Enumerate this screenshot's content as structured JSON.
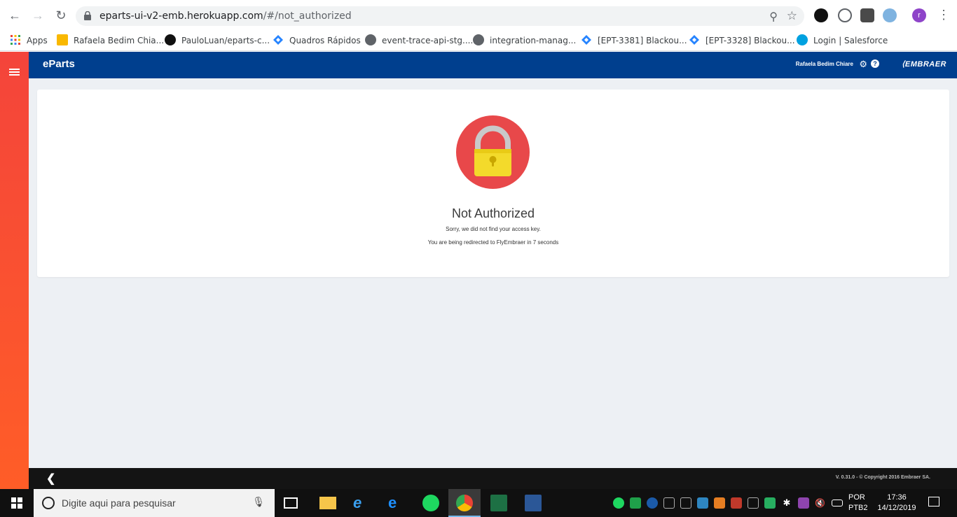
{
  "browser": {
    "url_host": "eparts-ui-v2-emb.herokuapp.com",
    "url_path": "/#/not_authorized",
    "profile_initial": "r",
    "bookmarks": [
      {
        "label": "Apps",
        "icon": "apps-grid-icon"
      },
      {
        "label": "Rafaela Bedim Chia...",
        "icon": "bookmark-o-icon"
      },
      {
        "label": "PauloLuan/eparts-c...",
        "icon": "github-icon"
      },
      {
        "label": "Quadros Rápidos",
        "icon": "jira-icon"
      },
      {
        "label": "event-trace-api-stg....",
        "icon": "globe-icon"
      },
      {
        "label": "integration-manag...",
        "icon": "globe-icon"
      },
      {
        "label": "[EPT-3381] Blackou...",
        "icon": "jira-icon"
      },
      {
        "label": "[EPT-3328] Blackou...",
        "icon": "jira-icon"
      },
      {
        "label": "Login | Salesforce",
        "icon": "salesforce-icon"
      }
    ]
  },
  "app": {
    "brand": "eParts",
    "user_name": "Rafaela Bedim Chiare",
    "logo_text": "EMBRAER"
  },
  "page": {
    "title": "Not Authorized",
    "message_line1": "Sorry, we did not find your access key.",
    "message_line2": "You are being redirected to FlyEmbraer in 7 seconds"
  },
  "footer": {
    "copyright": "V. 0.31.0 - © Copyright 2016 Embraer SA."
  },
  "taskbar": {
    "search_placeholder": "Digite aqui para pesquisar",
    "lang_line1": "POR",
    "lang_line2": "PTB2",
    "time": "17:36",
    "date": "14/12/2019"
  },
  "colors": {
    "header_blue": "#003f8e",
    "sidebar_orange": "#ff5d27",
    "lock_red": "#e8484a",
    "lock_yellow": "#f3da2b"
  }
}
